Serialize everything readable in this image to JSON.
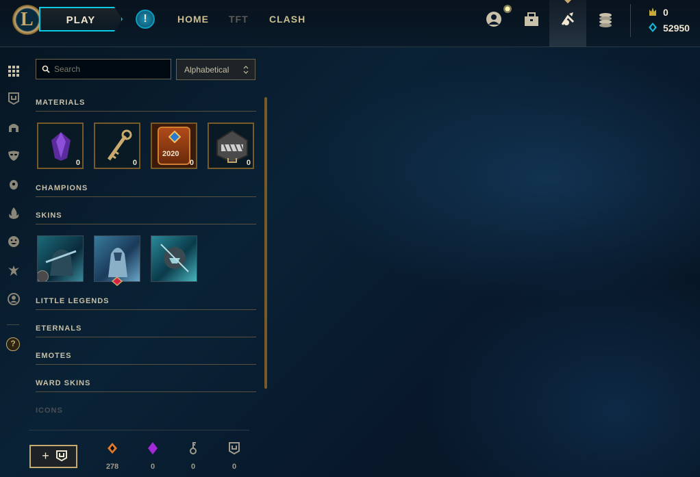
{
  "topbar": {
    "logo_letter": "L",
    "play_label": "PLAY",
    "alert_glyph": "!",
    "nav": [
      {
        "label": "HOME",
        "color": "#cdbe91"
      },
      {
        "label": "TFT",
        "color": "#5b5a56"
      },
      {
        "label": "CLASH",
        "color": "#cdbe91"
      }
    ],
    "icons": [
      "profile-icon",
      "collection-icon",
      "loot-icon",
      "store-icon"
    ],
    "currency": {
      "rp": "0",
      "be": "52950"
    }
  },
  "rail": [
    "grid-icon",
    "crest-icon",
    "helmet-icon",
    "mask-icon",
    "ward-icon",
    "flame-icon",
    "emote-icon",
    "eternal-icon",
    "icon-frame-icon",
    "help-icon"
  ],
  "rail_help_glyph": "?",
  "loot": {
    "search_placeholder": "Search",
    "sort_value": "Alphabetical",
    "categories": {
      "materials": "MATERIALS",
      "champions": "CHAMPIONS",
      "skins": "SKINS",
      "little_legends": "LITTLE LEGENDS",
      "eternals": "ETERNALS",
      "emotes": "EMOTES",
      "ward_skins": "WARD SKINS",
      "icons": "ICONS"
    },
    "materials": [
      {
        "name": "gemstone",
        "count": "0"
      },
      {
        "name": "key",
        "count": "0"
      },
      {
        "name": "2020-token",
        "count": "0",
        "label": "2020"
      },
      {
        "name": "chest",
        "count": "0"
      }
    ],
    "skins": [
      "skin-1",
      "skin-2",
      "skin-3"
    ]
  },
  "footer": {
    "craft_plus": "+",
    "resources": [
      {
        "name": "orange-essence",
        "count": "278"
      },
      {
        "name": "mythic-essence",
        "count": "0"
      },
      {
        "name": "key-fragment",
        "count": "0"
      },
      {
        "name": "champion-shard",
        "count": "0"
      }
    ]
  }
}
